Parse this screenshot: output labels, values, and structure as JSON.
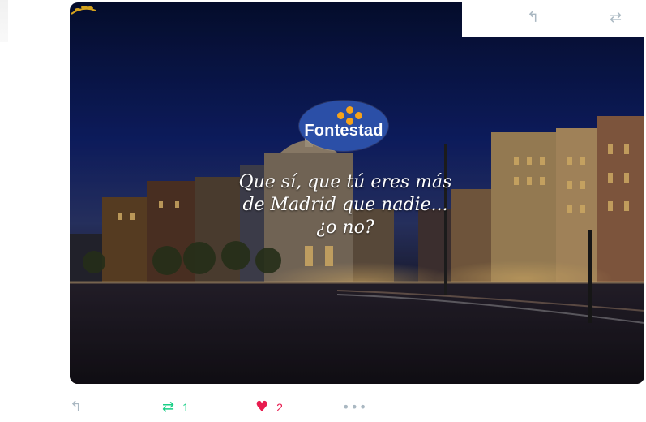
{
  "partial_tweet_actions": {
    "reply_icon": "reply-icon",
    "retweet_icon": "retweet-icon"
  },
  "media": {
    "logo_brand": "Fontestad",
    "tagline_line1": "Que sí, que tú eres más",
    "tagline_line2": "de Madrid que nadie...",
    "tagline_line3": "¿o no?"
  },
  "tweet_actions": {
    "reply_icon": "reply-icon",
    "retweet_icon": "retweet-icon",
    "retweet_count": "1",
    "like_icon": "heart-icon",
    "like_count": "2",
    "more_icon": "more-icon"
  },
  "colors": {
    "retweet": "#19cf86",
    "like": "#e81c4f",
    "muted": "#aab8c2",
    "logo_blue": "#2b4fa7",
    "logo_orange": "#f6a21a"
  }
}
